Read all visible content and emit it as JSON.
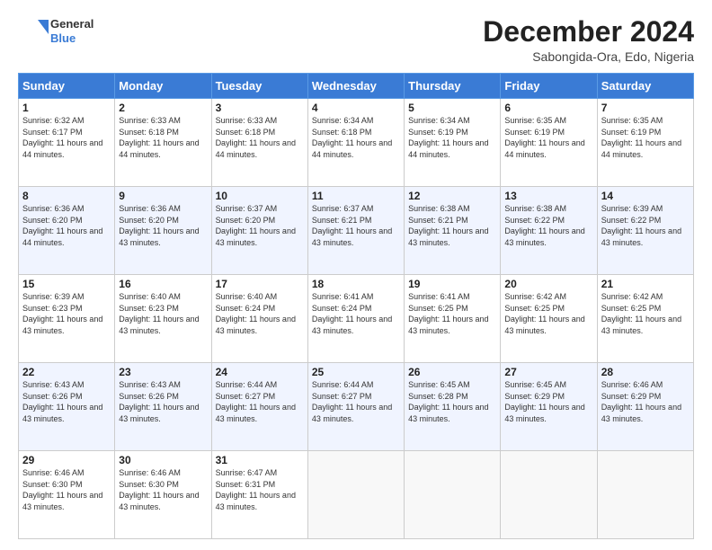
{
  "header": {
    "logo_line1": "General",
    "logo_line2": "Blue",
    "month": "December 2024",
    "location": "Sabongida-Ora, Edo, Nigeria"
  },
  "days_of_week": [
    "Sunday",
    "Monday",
    "Tuesday",
    "Wednesday",
    "Thursday",
    "Friday",
    "Saturday"
  ],
  "weeks": [
    [
      {
        "day": "1",
        "sunrise": "6:32 AM",
        "sunset": "6:17 PM",
        "daylight": "11 hours and 44 minutes."
      },
      {
        "day": "2",
        "sunrise": "6:33 AM",
        "sunset": "6:18 PM",
        "daylight": "11 hours and 44 minutes."
      },
      {
        "day": "3",
        "sunrise": "6:33 AM",
        "sunset": "6:18 PM",
        "daylight": "11 hours and 44 minutes."
      },
      {
        "day": "4",
        "sunrise": "6:34 AM",
        "sunset": "6:18 PM",
        "daylight": "11 hours and 44 minutes."
      },
      {
        "day": "5",
        "sunrise": "6:34 AM",
        "sunset": "6:19 PM",
        "daylight": "11 hours and 44 minutes."
      },
      {
        "day": "6",
        "sunrise": "6:35 AM",
        "sunset": "6:19 PM",
        "daylight": "11 hours and 44 minutes."
      },
      {
        "day": "7",
        "sunrise": "6:35 AM",
        "sunset": "6:19 PM",
        "daylight": "11 hours and 44 minutes."
      }
    ],
    [
      {
        "day": "8",
        "sunrise": "6:36 AM",
        "sunset": "6:20 PM",
        "daylight": "11 hours and 44 minutes."
      },
      {
        "day": "9",
        "sunrise": "6:36 AM",
        "sunset": "6:20 PM",
        "daylight": "11 hours and 43 minutes."
      },
      {
        "day": "10",
        "sunrise": "6:37 AM",
        "sunset": "6:20 PM",
        "daylight": "11 hours and 43 minutes."
      },
      {
        "day": "11",
        "sunrise": "6:37 AM",
        "sunset": "6:21 PM",
        "daylight": "11 hours and 43 minutes."
      },
      {
        "day": "12",
        "sunrise": "6:38 AM",
        "sunset": "6:21 PM",
        "daylight": "11 hours and 43 minutes."
      },
      {
        "day": "13",
        "sunrise": "6:38 AM",
        "sunset": "6:22 PM",
        "daylight": "11 hours and 43 minutes."
      },
      {
        "day": "14",
        "sunrise": "6:39 AM",
        "sunset": "6:22 PM",
        "daylight": "11 hours and 43 minutes."
      }
    ],
    [
      {
        "day": "15",
        "sunrise": "6:39 AM",
        "sunset": "6:23 PM",
        "daylight": "11 hours and 43 minutes."
      },
      {
        "day": "16",
        "sunrise": "6:40 AM",
        "sunset": "6:23 PM",
        "daylight": "11 hours and 43 minutes."
      },
      {
        "day": "17",
        "sunrise": "6:40 AM",
        "sunset": "6:24 PM",
        "daylight": "11 hours and 43 minutes."
      },
      {
        "day": "18",
        "sunrise": "6:41 AM",
        "sunset": "6:24 PM",
        "daylight": "11 hours and 43 minutes."
      },
      {
        "day": "19",
        "sunrise": "6:41 AM",
        "sunset": "6:25 PM",
        "daylight": "11 hours and 43 minutes."
      },
      {
        "day": "20",
        "sunrise": "6:42 AM",
        "sunset": "6:25 PM",
        "daylight": "11 hours and 43 minutes."
      },
      {
        "day": "21",
        "sunrise": "6:42 AM",
        "sunset": "6:25 PM",
        "daylight": "11 hours and 43 minutes."
      }
    ],
    [
      {
        "day": "22",
        "sunrise": "6:43 AM",
        "sunset": "6:26 PM",
        "daylight": "11 hours and 43 minutes."
      },
      {
        "day": "23",
        "sunrise": "6:43 AM",
        "sunset": "6:26 PM",
        "daylight": "11 hours and 43 minutes."
      },
      {
        "day": "24",
        "sunrise": "6:44 AM",
        "sunset": "6:27 PM",
        "daylight": "11 hours and 43 minutes."
      },
      {
        "day": "25",
        "sunrise": "6:44 AM",
        "sunset": "6:27 PM",
        "daylight": "11 hours and 43 minutes."
      },
      {
        "day": "26",
        "sunrise": "6:45 AM",
        "sunset": "6:28 PM",
        "daylight": "11 hours and 43 minutes."
      },
      {
        "day": "27",
        "sunrise": "6:45 AM",
        "sunset": "6:29 PM",
        "daylight": "11 hours and 43 minutes."
      },
      {
        "day": "28",
        "sunrise": "6:46 AM",
        "sunset": "6:29 PM",
        "daylight": "11 hours and 43 minutes."
      }
    ],
    [
      {
        "day": "29",
        "sunrise": "6:46 AM",
        "sunset": "6:30 PM",
        "daylight": "11 hours and 43 minutes."
      },
      {
        "day": "30",
        "sunrise": "6:46 AM",
        "sunset": "6:30 PM",
        "daylight": "11 hours and 43 minutes."
      },
      {
        "day": "31",
        "sunrise": "6:47 AM",
        "sunset": "6:31 PM",
        "daylight": "11 hours and 43 minutes."
      },
      null,
      null,
      null,
      null
    ]
  ]
}
